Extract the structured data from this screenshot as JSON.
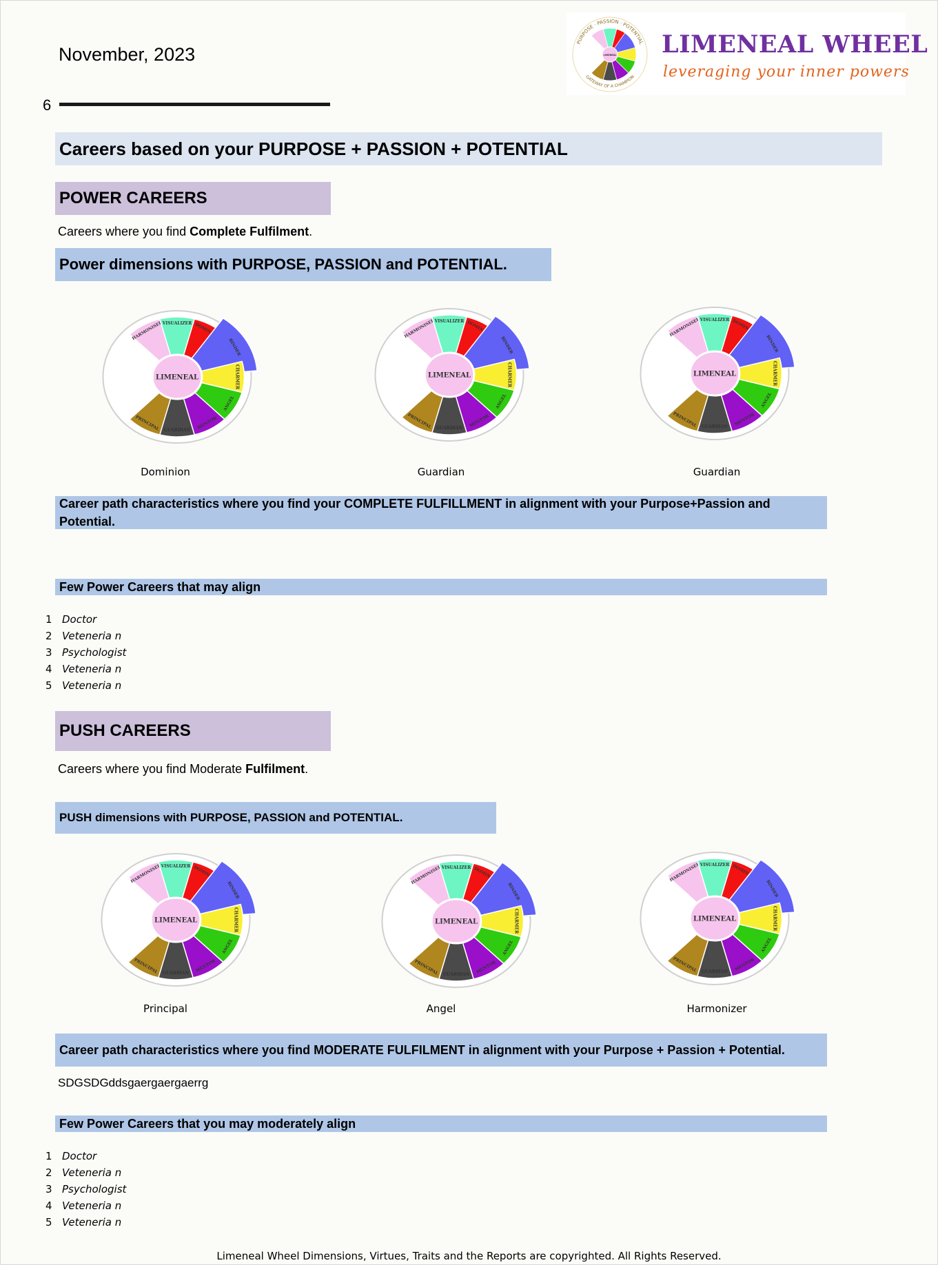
{
  "header": {
    "date": "November, 2023",
    "page_number": "6",
    "logo": {
      "brand": "LIMENEAL WHEEL",
      "tagline": "leveraging your inner powers",
      "ring_top": "PURPOSE · PASSION · POTENTIAL",
      "ring_bottom": "GATEWAY OF A CHAMPION",
      "center": "LIMENEAL"
    }
  },
  "main_heading": "Careers based on your PURPOSE + PASSION + POTENTIAL",
  "wheel": {
    "center_label": "LIMENEAL",
    "segments": [
      {
        "label": "HARMONISER",
        "color": "#f7c4ee"
      },
      {
        "label": "VISUALIZER",
        "color": "#6ef5c4"
      },
      {
        "label": "DOMINION",
        "color": "#f31212"
      },
      {
        "label": "BINDER",
        "color": "#6161f6"
      },
      {
        "label": "CHARMER",
        "color": "#f9ee32"
      },
      {
        "label": "ANGEL",
        "color": "#2fcb10"
      },
      {
        "label": "MENTOR",
        "color": "#9a0fc9"
      },
      {
        "label": "GUARDIAN",
        "color": "#4a4a4a"
      },
      {
        "label": "PRINCIPAL",
        "color": "#b0861e"
      }
    ]
  },
  "power": {
    "title": "POWER CAREERS",
    "desc_prefix": "Careers where you find ",
    "desc_bold": "Complete Fulfilment",
    "desc_suffix": ".",
    "dimensions_heading": "Power dimensions with PURPOSE, PASSION and POTENTIAL.",
    "wheel_captions": [
      "Dominion",
      "Guardian",
      "Guardian"
    ],
    "characteristics_heading": "Career path characteristics where you find your COMPLETE FULFILLMENT in alignment with your Purpose+Passion and Potential.",
    "few_heading": "Few Power Careers that may align",
    "careers": [
      {
        "num": "1",
        "name": "Doctor"
      },
      {
        "num": "2",
        "name": "Veteneria n"
      },
      {
        "num": "3",
        "name": "Psychologist"
      },
      {
        "num": "4",
        "name": "Veteneria n"
      },
      {
        "num": "5",
        "name": "Veteneria n"
      }
    ]
  },
  "push": {
    "title": "PUSH CAREERS",
    "desc_prefix": "Careers where you find Moderate ",
    "desc_bold": "Fulfilment",
    "desc_suffix": ".",
    "dimensions_heading": "PUSH dimensions with PURPOSE, PASSION and POTENTIAL.",
    "wheel_captions": [
      "Principal",
      "Angel",
      "Harmonizer"
    ],
    "characteristics_heading": "Career path characteristics where you find MODERATE FULFILMENT in alignment with your Purpose + Passion + Potential.",
    "characteristics_text": "SDGSDGddsgaergaergaerrg",
    "few_heading": "Few Power Careers that you may moderately align",
    "careers": [
      {
        "num": "1",
        "name": "Doctor"
      },
      {
        "num": "2",
        "name": "Veteneria n"
      },
      {
        "num": "3",
        "name": "Psychologist"
      },
      {
        "num": "4",
        "name": "Veteneria n"
      },
      {
        "num": "5",
        "name": "Veteneria n"
      }
    ]
  },
  "footer": "Limeneal Wheel Dimensions, Virtues, Traits and the Reports are copyrighted. All Rights Reserved."
}
